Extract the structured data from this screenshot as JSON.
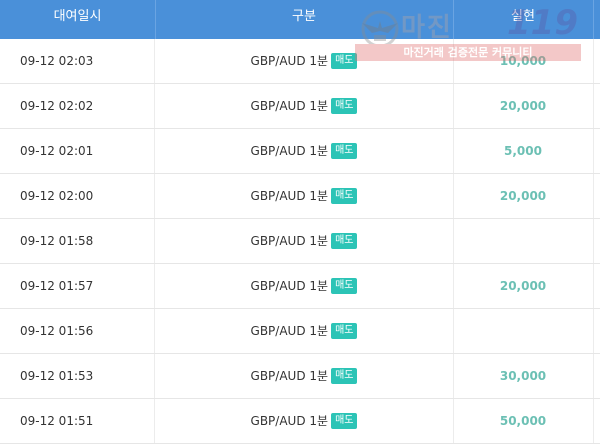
{
  "table": {
    "headers": [
      "대여일시",
      "구분",
      "실현"
    ],
    "rows": [
      {
        "datetime": "09-12 02:03",
        "pair": "GBP/AUD 1분",
        "badge": "매도",
        "amount": "10,000"
      },
      {
        "datetime": "09-12 02:02",
        "pair": "GBP/AUD 1분",
        "badge": "매도",
        "amount": "20,000"
      },
      {
        "datetime": "09-12 02:01",
        "pair": "GBP/AUD 1분",
        "badge": "매도",
        "amount": "5,000"
      },
      {
        "datetime": "09-12 02:00",
        "pair": "GBP/AUD 1분",
        "badge": "매도",
        "amount": "20,000"
      },
      {
        "datetime": "09-12 01:58",
        "pair": "GBP/AUD 1분",
        "badge": "매도",
        "amount": ""
      },
      {
        "datetime": "09-12 01:57",
        "pair": "GBP/AUD 1분",
        "badge": "매도",
        "amount": "20,000"
      },
      {
        "datetime": "09-12 01:56",
        "pair": "GBP/AUD 1분",
        "badge": "매도",
        "amount": ""
      },
      {
        "datetime": "09-12 01:53",
        "pair": "GBP/AUD 1분",
        "badge": "매도",
        "amount": "30,000"
      },
      {
        "datetime": "09-12 01:51",
        "pair": "GBP/AUD 1분",
        "badge": "매도",
        "amount": "50,000"
      }
    ]
  },
  "watermark": {
    "title": "마진",
    "number": "119",
    "subtitle": "마진거래 검증전문 커뮤니티"
  },
  "colors": {
    "header_bg": "#4a90d9",
    "badge_bg": "#2cc4b6",
    "amount_text": "#6cc0b4"
  }
}
